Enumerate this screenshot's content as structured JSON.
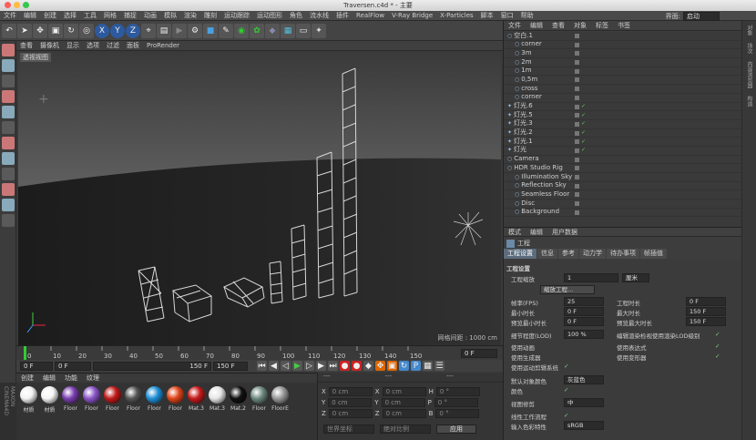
{
  "window": {
    "title": "Traversen.c4d * - 主要",
    "layout_label": "界面:",
    "layout_value": "启动"
  },
  "menubar": [
    "文件",
    "编辑",
    "创建",
    "选择",
    "工具",
    "网格",
    "捕捉",
    "动画",
    "模拟",
    "渲染",
    "雕刻",
    "运动跟踪",
    "运动图形",
    "角色",
    "流水线",
    "插件",
    "RealFlow",
    "V-Ray Bridge",
    "X-Particles",
    "脚本",
    "窗口",
    "帮助"
  ],
  "toolbar": {
    "icons": [
      "undo-icon",
      "select-icon",
      "move-icon",
      "scale-icon",
      "rotate-icon",
      "recent-icon",
      "x-axis-icon",
      "y-axis-icon",
      "z-axis-icon",
      "coord-icon",
      "render-region-icon",
      "render-view-icon",
      "render-settings-icon",
      "cube-icon",
      "pen-icon",
      "subdivision-icon",
      "array-icon",
      "deformer-icon",
      "floor-icon",
      "camera-icon",
      "light-icon"
    ],
    "axis_labels": [
      "X",
      "Y",
      "Z"
    ]
  },
  "viewport": {
    "menu": [
      "查看",
      "摄像机",
      "显示",
      "选项",
      "过滤",
      "面板",
      "ProRender"
    ],
    "label": "透视视图",
    "grid_text": "网格间距 : 1000 cm"
  },
  "timeline": {
    "ticks": [
      "0",
      "10",
      "20",
      "30",
      "40",
      "50",
      "60",
      "70",
      "80",
      "90",
      "100",
      "110",
      "120",
      "130",
      "140",
      "150"
    ],
    "frame_end": "0 F"
  },
  "transport": {
    "start": "0 F",
    "frame": "0 F",
    "end": "150 F",
    "end2": "150 F"
  },
  "materials": {
    "menu": [
      "创建",
      "编辑",
      "功能",
      "纹理"
    ],
    "items": [
      {
        "name": "材质",
        "color": "#f2f2f2"
      },
      {
        "name": "材质",
        "color": "#f5f5f5"
      },
      {
        "name": "Floor",
        "color": "#7a3fb0"
      },
      {
        "name": "Floor",
        "color": "#8a55c8"
      },
      {
        "name": "Floor",
        "color": "#c21a1a"
      },
      {
        "name": "Floor",
        "color": "#555555"
      },
      {
        "name": "Floor",
        "color": "#1f8fd6"
      },
      {
        "name": "Floor",
        "color": "#e0451a"
      },
      {
        "name": "Mat.3",
        "color": "#c71b1b"
      },
      {
        "name": "Mat.3",
        "color": "#e6e6e6"
      },
      {
        "name": "Mat.2",
        "color": "#111111"
      },
      {
        "name": "Floor",
        "color": "#6e8a80"
      },
      {
        "name": "FloorE",
        "color": "#999999"
      }
    ]
  },
  "coords": {
    "rows": [
      {
        "axis": "X",
        "v1": "0 cm",
        "a2": "X",
        "v2": "0 cm",
        "a3": "H",
        "v3": "0 °"
      },
      {
        "axis": "Y",
        "v1": "0 cm",
        "a2": "Y",
        "v2": "0 cm",
        "a3": "P",
        "v3": "0 °"
      },
      {
        "axis": "Z",
        "v1": "0 cm",
        "a2": "Z",
        "v2": "0 cm",
        "a3": "B",
        "v3": "0 °"
      }
    ],
    "mode": "世界坐标",
    "scale": "绝对比例",
    "apply": "应用"
  },
  "objects": {
    "menu": [
      "文件",
      "编辑",
      "查看",
      "对象",
      "标签",
      "书签"
    ],
    "items": [
      {
        "name": "空白.1",
        "check": ""
      },
      {
        "name": "corner",
        "check": ""
      },
      {
        "name": "3m",
        "check": ""
      },
      {
        "name": "2m",
        "check": ""
      },
      {
        "name": "1m",
        "check": ""
      },
      {
        "name": "0,5m",
        "check": ""
      },
      {
        "name": "cross",
        "check": ""
      },
      {
        "name": "corner",
        "check": ""
      },
      {
        "name": "灯光.6",
        "check": "✓"
      },
      {
        "name": "灯光.5",
        "check": "✓"
      },
      {
        "name": "灯光.3",
        "check": "✓"
      },
      {
        "name": "灯光.2",
        "check": "✓"
      },
      {
        "name": "灯光.1",
        "check": "✓"
      },
      {
        "name": "灯光",
        "check": "✓"
      },
      {
        "name": "Camera",
        "check": ""
      },
      {
        "name": "HDR Studio Rig",
        "check": ""
      },
      {
        "name": "Illumination Sky",
        "check": ""
      },
      {
        "name": "Reflection Sky",
        "check": ""
      },
      {
        "name": "Seamless Floor",
        "check": ""
      },
      {
        "name": "Disc",
        "check": ""
      },
      {
        "name": "Background",
        "check": ""
      }
    ]
  },
  "attributes": {
    "menu": [
      "模式",
      "编辑",
      "用户数据"
    ],
    "title": "工程",
    "tabs": [
      "工程设置",
      "信息",
      "参考",
      "动力学",
      "待办事项",
      "帧插值"
    ],
    "section": "工程设置",
    "rows": [
      {
        "label": "工程缩放",
        "value": "1",
        "unit": "厘米"
      },
      {
        "button": "缩放工程..."
      },
      {
        "label": "帧率(FPS)",
        "value": "25",
        "label2": "工程时长",
        "value2": "0 F"
      },
      {
        "label": "最小时长",
        "value": "0 F",
        "label2": "最大时长",
        "value2": "150 F"
      },
      {
        "label": "预览最小时长",
        "value": "0 F",
        "label2": "预览最大时长",
        "value2": "150 F"
      },
      {
        "label": "细节程度(LOD)",
        "value": "100 %",
        "label2": "编辑渲染检视使用渲染LOD级别"
      },
      {
        "label": "使用动画",
        "label2": "使用表达式"
      },
      {
        "label": "使用生成器",
        "label2": "使用变形器"
      },
      {
        "label": "使用运动剪辑系统"
      },
      {
        "label": "默认对象颜色",
        "value": "灰蓝色"
      },
      {
        "label": "颜色"
      },
      {
        "label": "视图修剪",
        "value": "中"
      },
      {
        "label": "线性工作流程"
      },
      {
        "label": "输入色彩特性",
        "value": "sRGB"
      }
    ]
  },
  "side_tabs": [
    "对象",
    "场次",
    "内容浏览器",
    "构造"
  ]
}
